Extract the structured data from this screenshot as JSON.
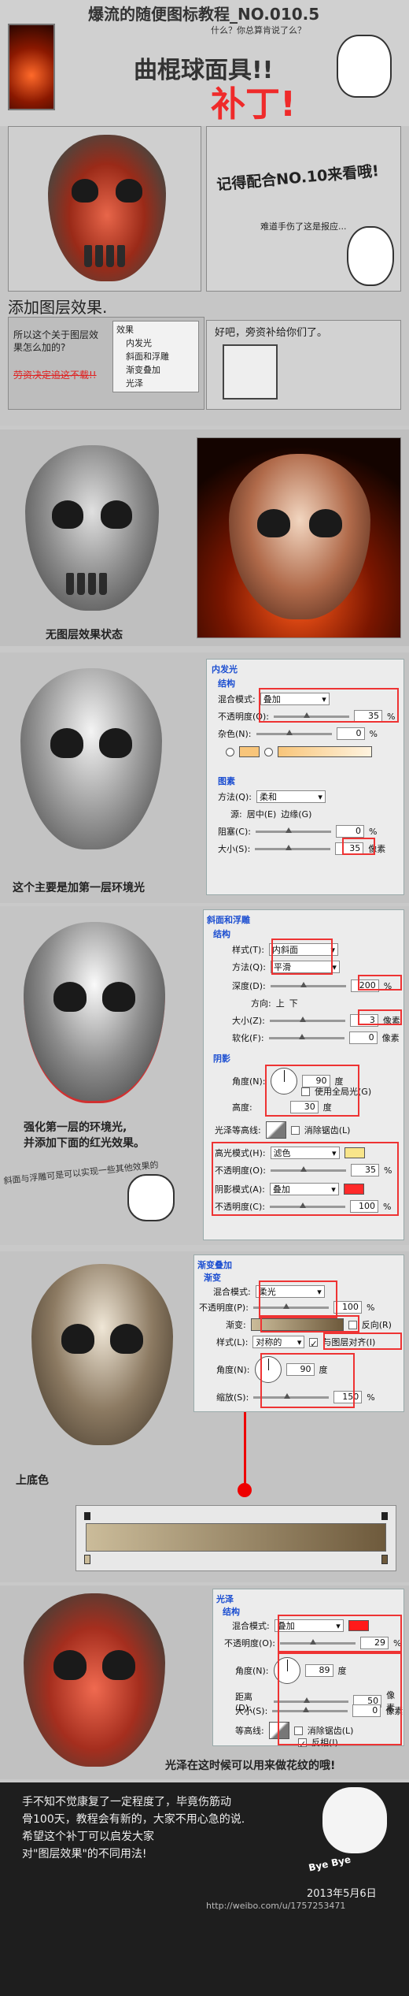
{
  "header": {
    "title": "爆流的随便图标教程_NO.010.5",
    "subtitle": "什么？你总算肯说了么？",
    "big_title": "曲棍球面具!!",
    "red_title": "补丁!"
  },
  "section1": {
    "text1": "记得配合NO.10来看哦!",
    "text2": "难道手伤了这是报应...",
    "heading": "添加图层效果.",
    "question": "所以这个关于图层效果怎么加的?",
    "strike": "劳资决定追这不载!!",
    "answer": "好吧，旁资补给你们了。",
    "menu": [
      "效果",
      "内发光",
      "斜面和浮雕",
      "渐变叠加",
      "光泽"
    ]
  },
  "section2": {
    "caption": "无图层效果状态"
  },
  "section3": {
    "panel_title": "内发光",
    "group_structure": "结构",
    "blend_label": "混合模式:",
    "blend_value": "叠加",
    "opacity_label": "不透明度(O):",
    "opacity_value": "35",
    "noise_label": "杂色(N):",
    "noise_value": "0",
    "group_elements": "图素",
    "method_label": "方法(Q):",
    "method_value": "柔和",
    "source_label": "源:",
    "source_center": "居中(E)",
    "source_edge": "边缘(G)",
    "choke_label": "阻塞(C):",
    "choke_value": "0",
    "size_label": "大小(S):",
    "size_value": "35",
    "unit_px": "像素",
    "unit_pct": "%",
    "caption": "这个主要是加第一层环境光"
  },
  "section4": {
    "panel_title": "斜面和浮雕",
    "group_structure": "结构",
    "style_label": "样式(T):",
    "style_value": "内斜面",
    "technique_label": "方法(Q):",
    "technique_value": "平滑",
    "depth_label": "深度(D):",
    "depth_value": "200",
    "direction_label": "方向:",
    "direction_up": "上",
    "direction_down": "下",
    "size_label": "大小(Z):",
    "size_value": "3",
    "soften_label": "软化(F):",
    "soften_value": "0",
    "group_shading": "阴影",
    "angle_label": "角度(N):",
    "angle_value": "90",
    "angle_unit": "度",
    "global_light": "使用全局光(G)",
    "altitude_label": "高度:",
    "altitude_value": "30",
    "gloss_label": "光泽等高线:",
    "anti_alias": "消除锯齿(L)",
    "highlight_label": "高光模式(H):",
    "highlight_value": "滤色",
    "highlight_opacity": "35",
    "opacity_label": "不透明度(O):",
    "shadow_label": "阴影模式(A):",
    "shadow_value": "叠加",
    "shadow_opacity": "100",
    "opacity_label2": "不透明度(C):",
    "caption1": "强化第一层的环境光,",
    "caption2": "并添加下面的红光效果。",
    "caption3": "斜面与浮雕可是可以实现一些其他效果的",
    "unit_pct": "%",
    "unit_px": "像素"
  },
  "section5": {
    "panel_title": "渐变叠加",
    "group_title": "渐变",
    "blend_label": "混合模式:",
    "blend_value": "柔光",
    "opacity_label": "不透明度(P):",
    "opacity_value": "100",
    "gradient_label": "渐变:",
    "reverse_label": "反向(R)",
    "style_label": "样式(L):",
    "style_value": "对称的",
    "align_label": "与图层对齐(I)",
    "angle_label": "角度(N):",
    "angle_value": "90",
    "angle_unit": "度",
    "scale_label": "缩放(S):",
    "scale_value": "150",
    "unit_pct": "%",
    "caption": "上底色"
  },
  "section6": {
    "panel_title": "光泽",
    "group_structure": "结构",
    "blend_label": "混合模式:",
    "blend_value": "叠加",
    "opacity_label": "不透明度(O):",
    "opacity_value": "29",
    "angle_label": "角度(N):",
    "angle_value": "89",
    "angle_unit": "度",
    "distance_label": "距离(D):",
    "distance_value": "50",
    "size_label": "大小(S):",
    "size_value": "0",
    "contour_label": "等高线:",
    "anti_alias": "消除锯齿(L)",
    "invert": "反相(I)",
    "unit_px": "像素",
    "unit_pct": "%",
    "caption": "光泽在这时候可以用来做花纹的哦!"
  },
  "footer": {
    "line1": "手不知不觉康复了一定程度了，毕竟伤筋动",
    "line2": "骨100天，教程会有新的，大家不用心急的说.",
    "line3": "希望这个补丁可以启发大家",
    "line4": "对\"图层效果\"的不同用法!",
    "bubble": "Bye Bye",
    "date": "2013年5月6日",
    "weibo": "http://weibo.com/u/1757253471"
  },
  "colors": {
    "accent_red": "#e02020",
    "dialog_blue": "#1d4fd1",
    "bg_gray": "#c9c9c9",
    "yellow_swatch": "#f8e58a",
    "red_swatch": "#ff1a1a"
  }
}
